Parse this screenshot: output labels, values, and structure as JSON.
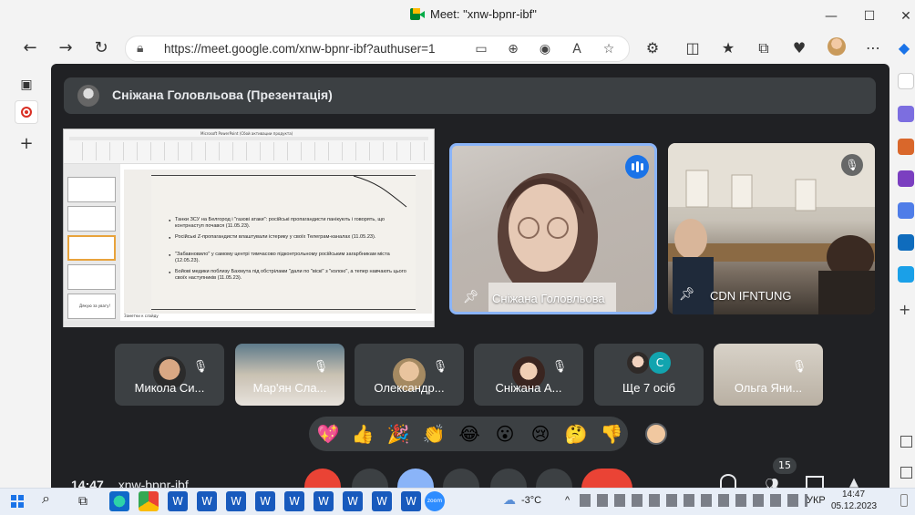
{
  "browser": {
    "tab_title": "Meet: \"xnw-bpnr-ibf\"",
    "url": "https://meet.google.com/xnw-bpnr-ibf?authuser=1"
  },
  "meet": {
    "presenter_title": "Сніжана Головльова (Презентація)",
    "tiles_large": [
      {
        "name": "Сніжана Головльова",
        "state": "speaking"
      },
      {
        "name": "CDN IFNTUNG",
        "state": "muted"
      }
    ],
    "tiles_small": [
      {
        "name": "Микола Си..."
      },
      {
        "name": "Мар'ян Сла..."
      },
      {
        "name": "Олександр..."
      },
      {
        "name": "Сніжана А..."
      },
      {
        "name": "Ще 7 осіб",
        "avatar_letter": "C"
      },
      {
        "name": "Ольга Яни..."
      }
    ],
    "reactions": [
      "💖",
      "👍",
      "🎉",
      "👏",
      "😂",
      "😮",
      "😢",
      "🤔",
      "👎"
    ],
    "bottom": {
      "time": "14:47",
      "meeting_code": "xnw-bpnr-ibf",
      "participants_count": "15"
    }
  },
  "slide": {
    "window_title": "Microsoft PowerPoint (Сбой активации продукта)",
    "bullets": [
      "Танки ЗСУ на Белгород і \"газові атаки\": російські пропагандисти панікують і говорять, що контрнаступ почався (11.05.23).",
      "Російські Z-пропагандисти влаштували істерику у своїх Телеграм-каналах (11.05.23).",
      "\"Забавновило\" у самому центрі тимчасово підконтрольному російським загарбникам міста (12.05.23).",
      "Бойові медики поблизу Бахмута під обстрілами \"дали по \"віскі\" з \"колою\", а тепер навчають цього своїх наступників (11.05.23)."
    ],
    "notes": "Заметки к слайду",
    "last_thumb_text": "Дякую за увагу!"
  },
  "taskbar": {
    "weather": "-3°C",
    "lang": "УКР",
    "time": "14:47",
    "date": "05.12.2023"
  }
}
